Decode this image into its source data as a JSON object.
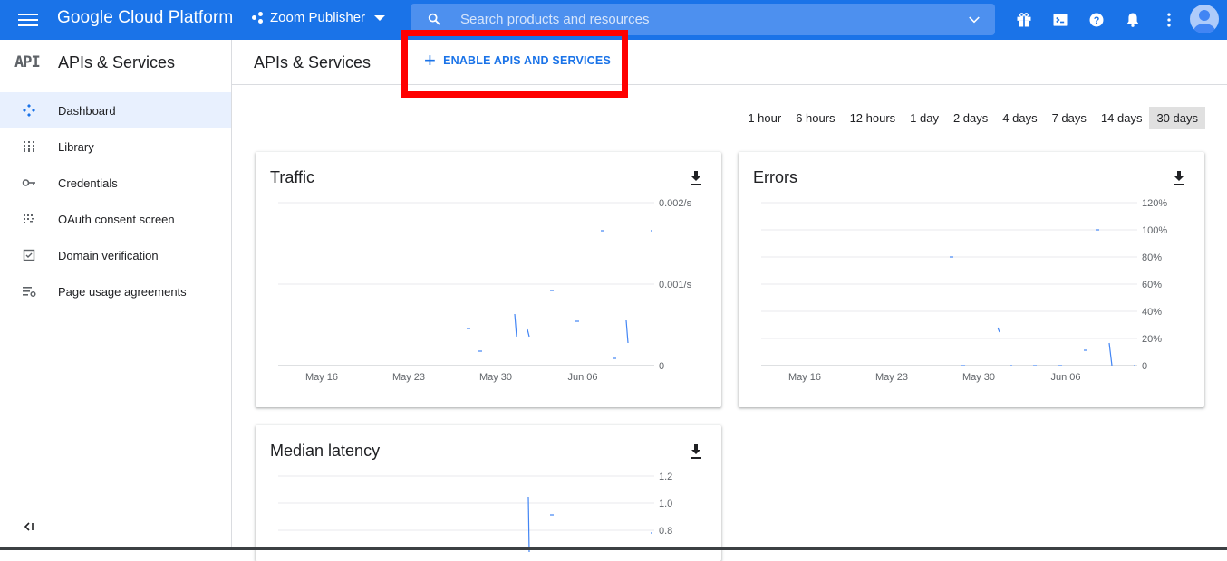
{
  "topbar": {
    "brand": "Google Cloud Platform",
    "project": "Zoom Publisher",
    "search_placeholder": "Search products and resources"
  },
  "sidebar": {
    "logo": "API",
    "title": "APIs & Services",
    "items": [
      {
        "label": "Dashboard",
        "icon": "dashboard-icon",
        "active": true
      },
      {
        "label": "Library",
        "icon": "library-icon"
      },
      {
        "label": "Credentials",
        "icon": "key-icon"
      },
      {
        "label": "OAuth consent screen",
        "icon": "oauth-icon"
      },
      {
        "label": "Domain verification",
        "icon": "checkbox-icon"
      },
      {
        "label": "Page usage agreements",
        "icon": "settings-list-icon"
      }
    ]
  },
  "header": {
    "title": "APIs & Services",
    "enable_label": "ENABLE APIS AND SERVICES"
  },
  "time_ranges": [
    "1 hour",
    "6 hours",
    "12 hours",
    "1 day",
    "2 days",
    "4 days",
    "7 days",
    "14 days",
    "30 days"
  ],
  "selected_range": "30 days",
  "colors": {
    "accent": "#1a73e8",
    "highlight": "#ff0000",
    "series": "#4285f4"
  },
  "chart_data": [
    {
      "title": "Traffic",
      "type": "line",
      "x_ticks": [
        "May 16",
        "May 23",
        "May 30",
        "Jun 06"
      ],
      "y_ticks": [
        "0.002/s",
        "0.001/s",
        "0"
      ]
    },
    {
      "title": "Errors",
      "type": "line",
      "x_ticks": [
        "May 16",
        "May 23",
        "May 30",
        "Jun 06"
      ],
      "y_ticks": [
        "120%",
        "100%",
        "80%",
        "60%",
        "40%",
        "20%",
        "0"
      ]
    },
    {
      "title": "Median latency",
      "type": "line",
      "y_ticks": [
        "1.2",
        "1.0",
        "0.8"
      ]
    }
  ]
}
